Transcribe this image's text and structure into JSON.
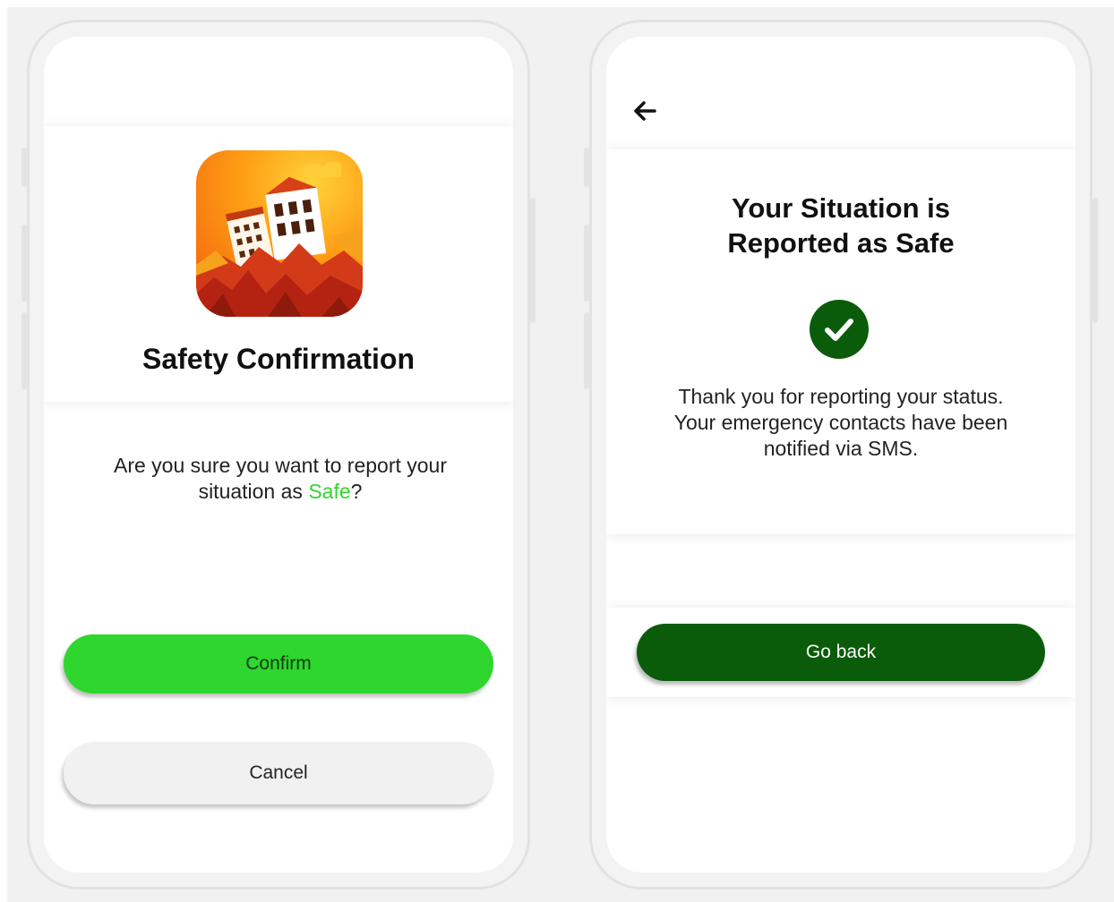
{
  "confirm_screen": {
    "title": "Safety Confirmation",
    "question_prefix": "Are you sure you want to report your situation as ",
    "question_highlight": "Safe",
    "question_suffix": "?",
    "confirm_label": "Confirm",
    "cancel_label": "Cancel",
    "app_icon": "earthquake-buildings-app-icon"
  },
  "result_screen": {
    "back_icon": "arrow-left-icon",
    "title_line1": "Your Situation is",
    "title_line2": "Reported as Safe",
    "status_icon": "check-circle-icon",
    "message": "Thank you for reporting your status. Your emergency contacts have been notified via SMS.",
    "go_back_label": "Go back"
  },
  "colors": {
    "confirm_green": "#2ed62e",
    "safe_highlight": "#2ed62e",
    "dark_green": "#0a5c0a",
    "cancel_gray": "#f1f1f1"
  }
}
